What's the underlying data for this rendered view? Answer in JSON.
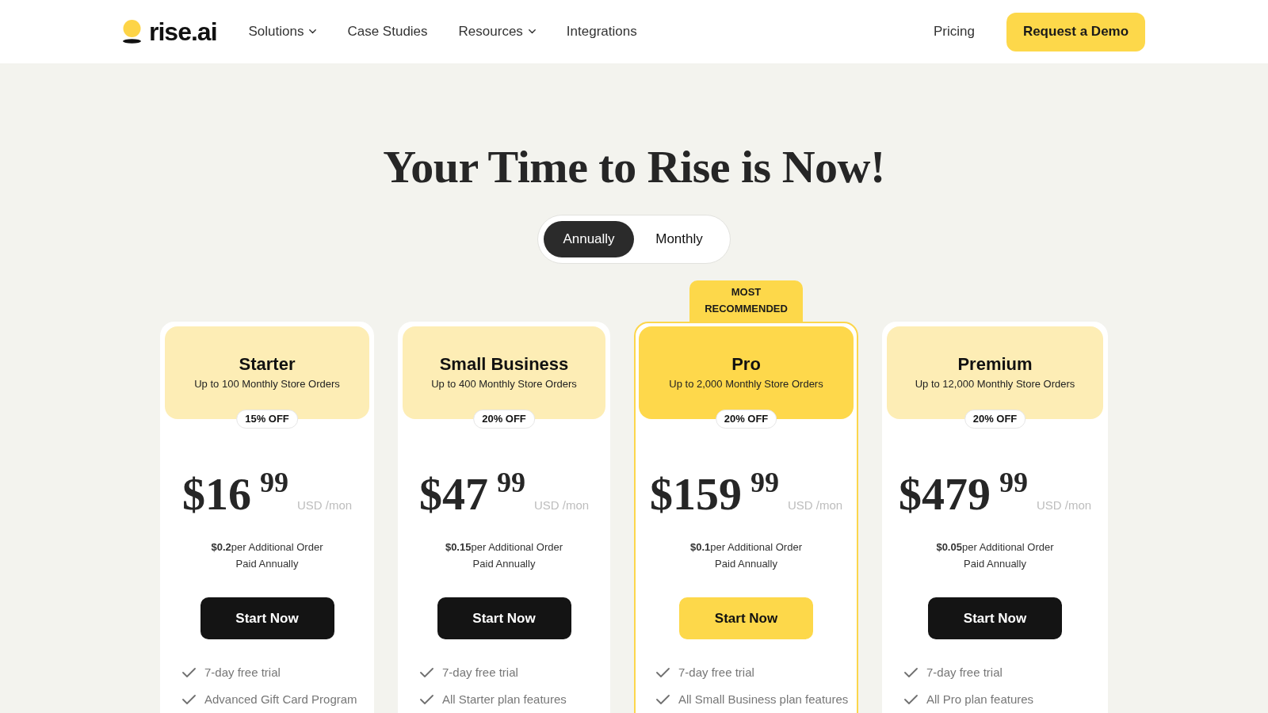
{
  "header": {
    "logo": {
      "text": "rise.ai"
    },
    "nav": [
      {
        "label": "Solutions",
        "dropdown": true
      },
      {
        "label": "Case Studies",
        "dropdown": false
      },
      {
        "label": "Resources",
        "dropdown": true
      },
      {
        "label": "Integrations",
        "dropdown": false
      }
    ],
    "pricing_link": "Pricing",
    "demo_button": "Request a Demo"
  },
  "hero": {
    "title": "Your Time to Rise is Now!"
  },
  "billing_toggle": {
    "options": [
      {
        "label": "Annually",
        "selected": true
      },
      {
        "label": "Monthly",
        "selected": false
      }
    ]
  },
  "plans": [
    {
      "name": "Starter",
      "subtitle": "Up to 100 Monthly Store Orders",
      "discount": "15% OFF",
      "price": "$16",
      "cents": "99",
      "unit": "USD /mon",
      "per_order": "**$0.2**per Additional Order",
      "billing": "Paid Annually",
      "button": "Start Now",
      "featured": false,
      "features": [
        "7-day free trial",
        "Advanced Gift Card Program"
      ]
    },
    {
      "name": "Small Business",
      "subtitle": "Up to 400 Monthly Store Orders",
      "discount": "20% OFF",
      "price": "$47",
      "cents": "99",
      "unit": "USD /mon",
      "per_order": "**$0.15**per Additional Order",
      "billing": "Paid Annually",
      "button": "Start Now",
      "featured": false,
      "features": [
        "7-day free trial",
        "All Starter plan features"
      ]
    },
    {
      "badge": "MOST RECOMMENDED",
      "name": "Pro",
      "subtitle": "Up to 2,000 Monthly Store Orders",
      "discount": "20% OFF",
      "price": "$159",
      "cents": "99",
      "unit": "USD /mon",
      "per_order": "**$0.1**per Additional Order",
      "billing": "Paid Annually",
      "button": "Start Now",
      "featured": true,
      "features": [
        "7-day free trial",
        "All Small Business plan features"
      ]
    },
    {
      "name": "Premium",
      "subtitle": "Up to 12,000 Monthly Store Orders",
      "discount": "20% OFF",
      "price": "$479",
      "cents": "99",
      "unit": "USD /mon",
      "per_order": "**$0.05**per Additional Order",
      "billing": "Paid Annually",
      "button": "Start Now",
      "featured": false,
      "features": [
        "7-day free trial",
        "All Pro plan features"
      ]
    }
  ]
}
